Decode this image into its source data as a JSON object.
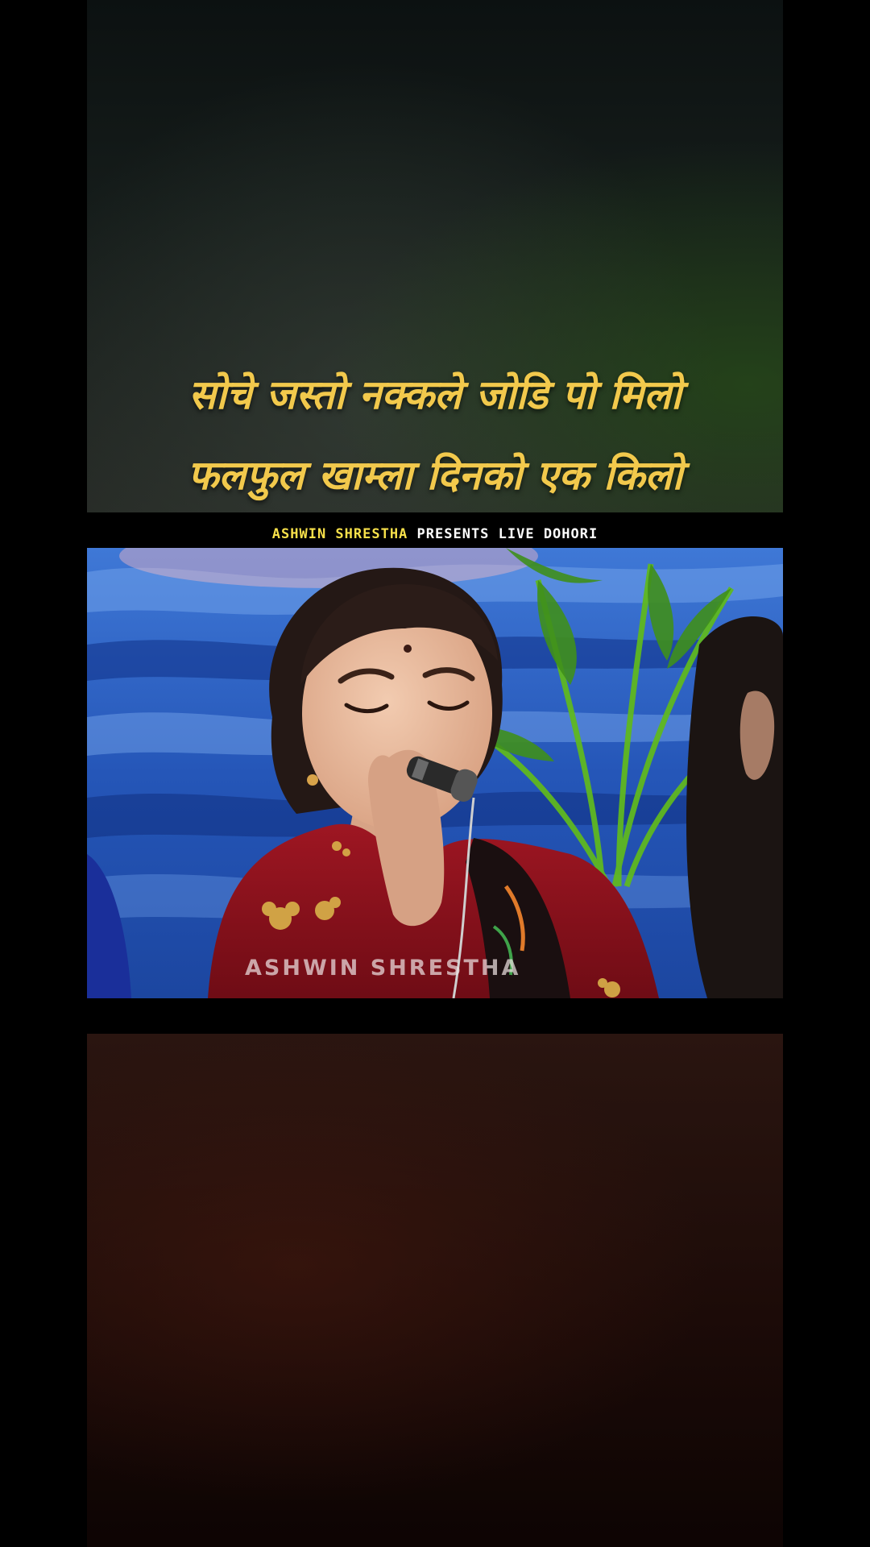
{
  "lyrics": {
    "line1": "सोचे जस्तो नक्कले जोडि पो मिलो",
    "line2": "फलफुल खाम्ला दिनको एक किलो"
  },
  "banner": {
    "brand": "ASHWIN SHRESTHA",
    "rest": " PRESENTS LIVE DOHORI"
  },
  "video": {
    "watermark": "ASHWIN SHRESTHA"
  },
  "colors": {
    "lyric_yellow": "#f2c94c",
    "brand_yellow": "#f7e04a"
  }
}
